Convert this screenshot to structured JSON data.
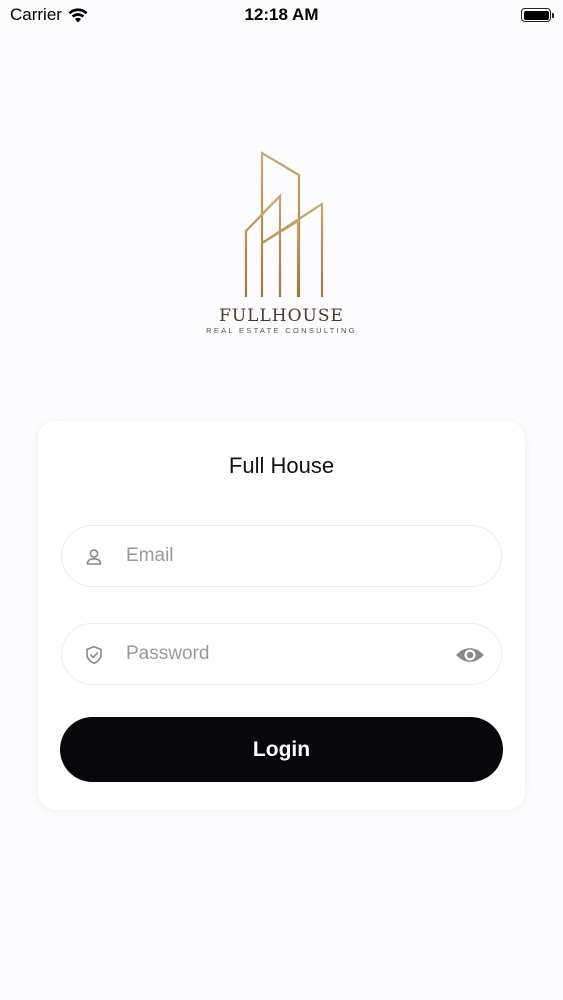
{
  "status_bar": {
    "carrier": "Carrier",
    "time": "12:18 AM"
  },
  "logo": {
    "wordmark": "FULLHOUSE",
    "tagline": "REAL ESTATE CONSULTING"
  },
  "login_card": {
    "title": "Full House",
    "email_placeholder": "Email",
    "password_placeholder": "Password",
    "login_label": "Login"
  },
  "colors": {
    "background": "#fcfbfd",
    "logo_gold": "#b8955a",
    "button": "#07070c",
    "placeholder": "#9a9a9a"
  }
}
